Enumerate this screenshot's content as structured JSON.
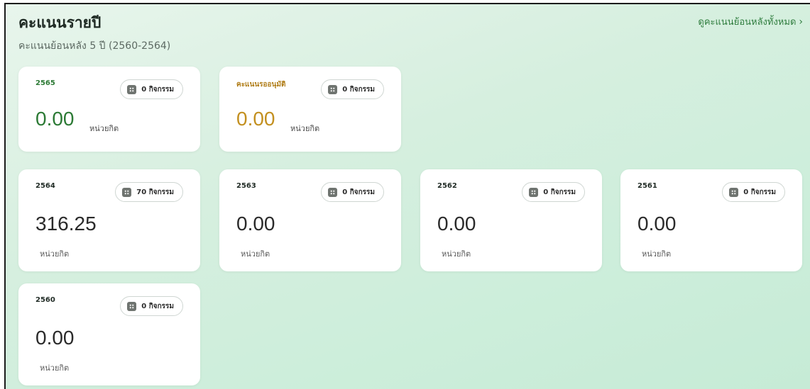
{
  "header": {
    "title": "คะแนนรายปี",
    "subtitle": "คะแนนย้อนหลัง 5 ปี (2560-2564)",
    "view_all": "ดูคะแนนย้อนหลังทั้งหมด",
    "view_all_icon": "chevron-right-icon"
  },
  "top_cards": [
    {
      "label": "2565",
      "activities": "0 กิจกรรม",
      "value": "0.00",
      "unit": "หน่วยกิต",
      "color": "#2c7a35"
    },
    {
      "label": "คะแนนรออนุมัติ",
      "activities": "0 กิจกรรม",
      "value": "0.00",
      "unit": "หน่วยกิต",
      "color": "#c39020"
    }
  ],
  "year_cards": [
    {
      "label": "2564",
      "activities": "70 กิจกรรม",
      "value": "316.25",
      "unit": "หน่วยกิต"
    },
    {
      "label": "2563",
      "activities": "0 กิจกรรม",
      "value": "0.00",
      "unit": "หน่วยกิต"
    },
    {
      "label": "2562",
      "activities": "0 กิจกรรม",
      "value": "0.00",
      "unit": "หน่วยกิต"
    },
    {
      "label": "2561",
      "activities": "0 กิจกรรม",
      "value": "0.00",
      "unit": "หน่วยกิต"
    },
    {
      "label": "2560",
      "activities": "0 กิจกรรม",
      "value": "0.00",
      "unit": "หน่วยกิต"
    }
  ]
}
